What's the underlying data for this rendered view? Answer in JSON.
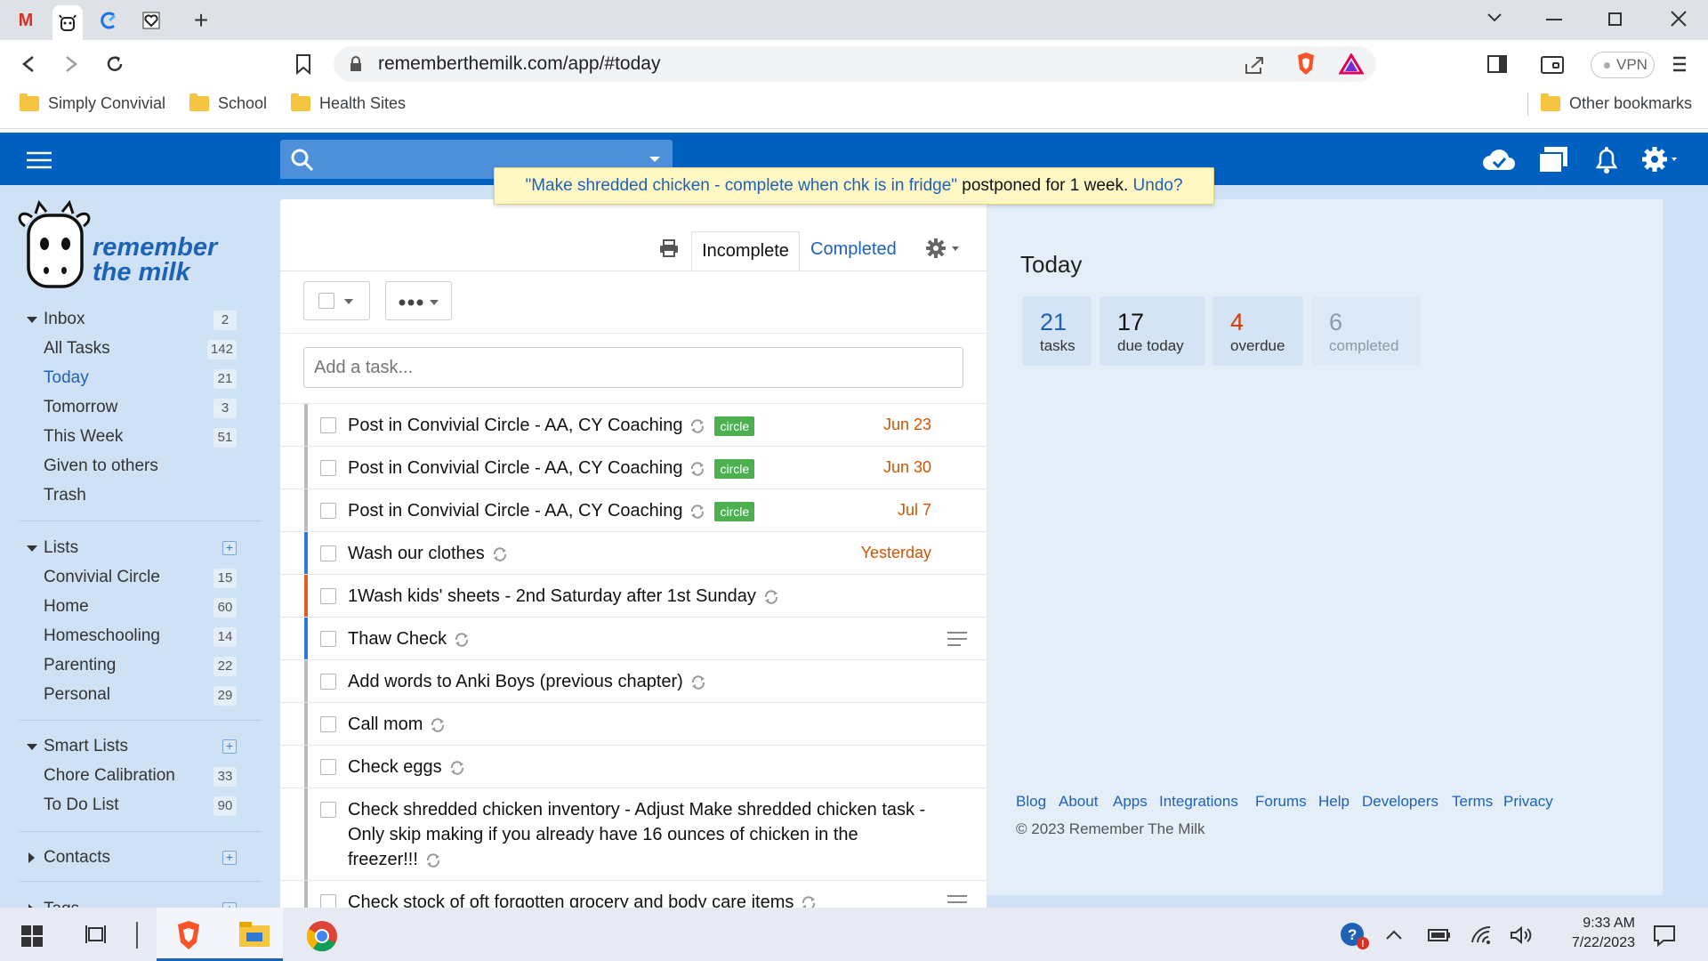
{
  "browser": {
    "url": "rememberthemilk.com/app/#today",
    "vpn_label": "VPN",
    "bookmarks": [
      {
        "label": "Simply Convivial"
      },
      {
        "label": "School"
      },
      {
        "label": "Health Sites"
      }
    ],
    "other_bookmarks": "Other bookmarks"
  },
  "notice": {
    "task_quote": "\"Make shredded chicken - complete when chk is in fridge\"",
    "message": " postponed for 1 week. ",
    "undo": "Undo?"
  },
  "logo": {
    "line1": "remember",
    "line2": "the milk"
  },
  "sidebar": {
    "inbox": {
      "label": "Inbox",
      "count": "2"
    },
    "inbox_items": [
      {
        "label": "All Tasks",
        "count": "142"
      },
      {
        "label": "Today",
        "count": "21"
      },
      {
        "label": "Tomorrow",
        "count": "3"
      },
      {
        "label": "This Week",
        "count": "51"
      },
      {
        "label": "Given to others",
        "count": ""
      },
      {
        "label": "Trash",
        "count": ""
      }
    ],
    "lists_label": "Lists",
    "lists": [
      {
        "label": "Convivial Circle",
        "count": "15"
      },
      {
        "label": "Home",
        "count": "60"
      },
      {
        "label": "Homeschooling",
        "count": "14"
      },
      {
        "label": "Parenting",
        "count": "22"
      },
      {
        "label": "Personal",
        "count": "29"
      }
    ],
    "smart_lists_label": "Smart Lists",
    "smart_lists": [
      {
        "label": "Chore Calibration",
        "count": "33"
      },
      {
        "label": "To Do List",
        "count": "90"
      }
    ],
    "contacts_label": "Contacts",
    "tags_label": "Tags"
  },
  "tasklist": {
    "tab_incomplete": "Incomplete",
    "tab_completed": "Completed",
    "add_placeholder": "Add a task...",
    "tasks": [
      {
        "text": "Post in Convivial Circle - AA, CY Coaching",
        "tag": "circle",
        "due": "Jun 23"
      },
      {
        "text": "Post in Convivial Circle - AA, CY Coaching",
        "tag": "circle",
        "due": "Jun 30"
      },
      {
        "text": "Post in Convivial Circle - AA, CY Coaching",
        "tag": "circle",
        "due": "Jul 7"
      },
      {
        "text": "Wash our clothes",
        "due": "Yesterday"
      },
      {
        "text": "1Wash kids' sheets - 2nd Saturday after 1st Sunday"
      },
      {
        "text": "Thaw Check"
      },
      {
        "text": "Add words to Anki Boys (previous chapter)"
      },
      {
        "text": "Call mom"
      },
      {
        "text": "Check eggs"
      },
      {
        "text": "Check shredded chicken inventory - Adjust Make shredded chicken task -",
        "text2": "Only skip making if you already have 16 ounces of chicken in the",
        "text3": "freezer!!!"
      },
      {
        "text": "Check stock of oft forgotten grocery and body care items"
      }
    ]
  },
  "summary": {
    "title": "Today",
    "stats": [
      {
        "num": "21",
        "label": "tasks"
      },
      {
        "num": "17",
        "label": "due today"
      },
      {
        "num": "4",
        "label": "overdue"
      },
      {
        "num": "6",
        "label": "completed"
      }
    ],
    "colors": {
      "tasks": "#1e62b8",
      "due": "#111111",
      "overdue": "#d33a00",
      "completed": "#8a9aab"
    }
  },
  "footer": {
    "links": [
      "Blog",
      "About",
      "Apps",
      "Integrations",
      "Forums",
      "Help",
      "Developers",
      "Terms",
      "Privacy"
    ],
    "copyright": "© 2023 Remember The Milk"
  },
  "taskbar": {
    "time": "9:33 AM",
    "date": "7/22/2023"
  }
}
